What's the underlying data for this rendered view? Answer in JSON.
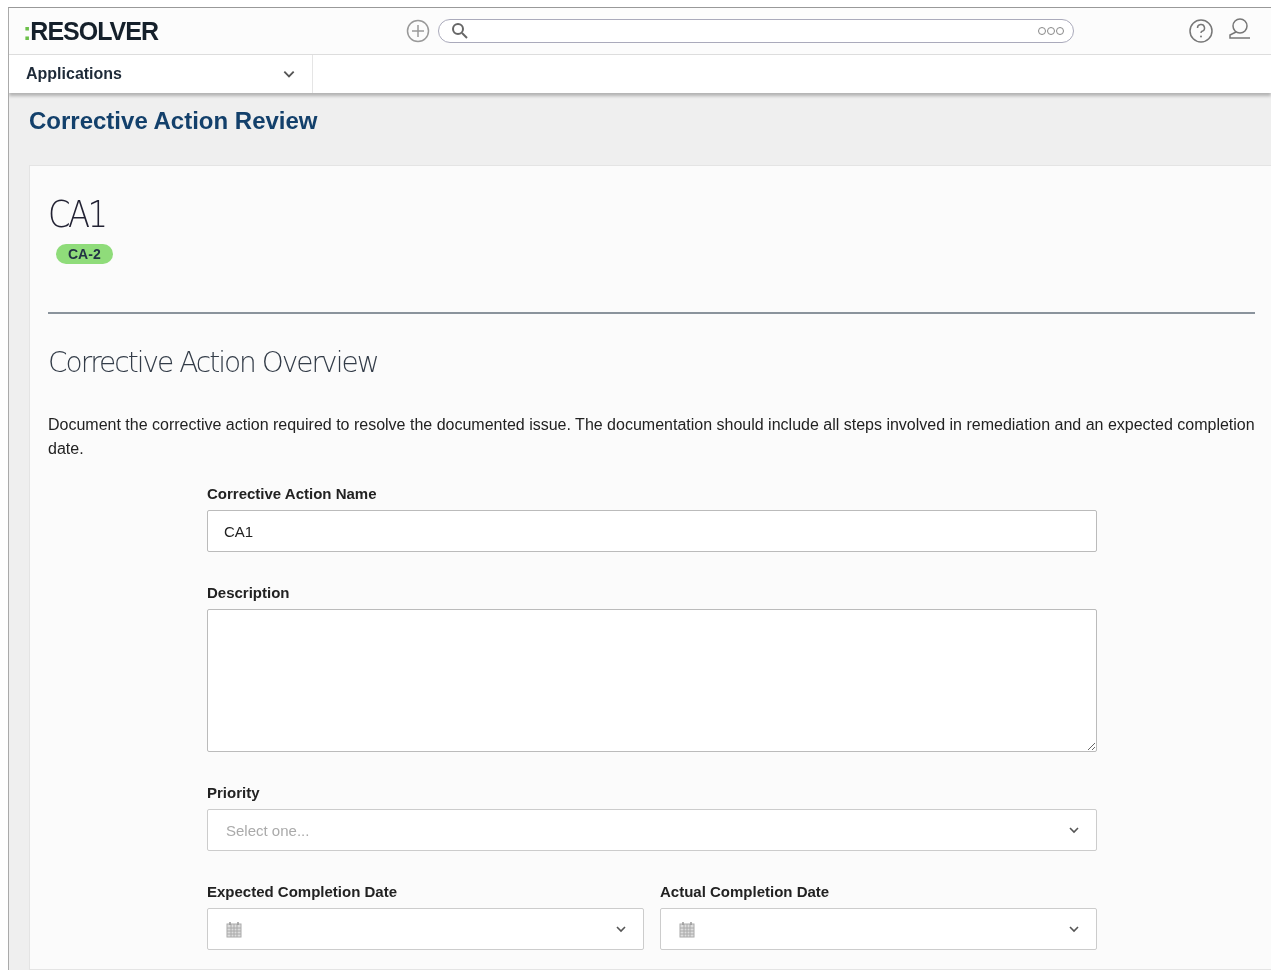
{
  "header": {
    "logo": {
      "mark": ":",
      "name": "RESOLVER"
    }
  },
  "nav": {
    "label": "Applications"
  },
  "page_title": "Corrective Action Review",
  "record": {
    "title": "CA1",
    "badge": "CA-2"
  },
  "section": {
    "title": "Corrective Action Overview",
    "description": "Document the corrective action required to resolve the documented issue. The documentation should include all steps involved in remediation and an expected completion date."
  },
  "fields": [
    {
      "kind": "text",
      "label": "Corrective Action Name",
      "value": "CA1"
    },
    {
      "kind": "textarea",
      "label": "Description"
    },
    {
      "kind": "select",
      "label": "Priority",
      "placeholder": "Select one..."
    },
    {
      "kind": "dates",
      "items": [
        {
          "label": "Expected Completion Date"
        },
        {
          "label": "Actual Completion Date"
        }
      ]
    }
  ]
}
